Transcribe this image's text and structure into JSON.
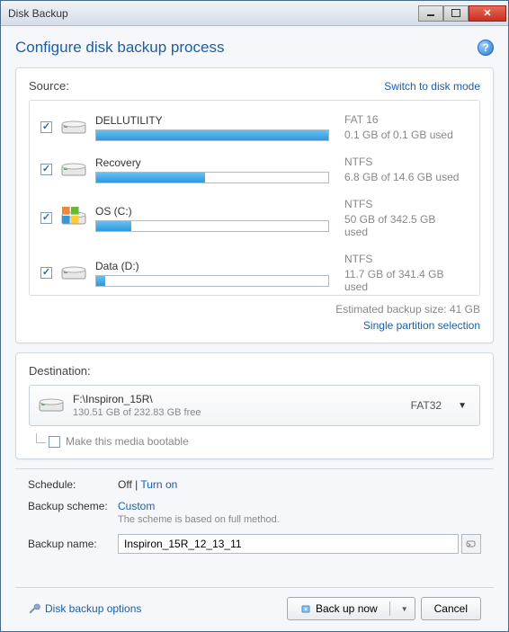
{
  "window": {
    "title": "Disk Backup"
  },
  "header": {
    "title": "Configure disk backup process"
  },
  "source": {
    "label": "Source:",
    "switch_link": "Switch to disk mode",
    "items": [
      {
        "name": "DELLUTILITY",
        "fs": "FAT 16",
        "usage": "0.1 GB of 0.1 GB used",
        "pct": 100,
        "checked": true,
        "os": false
      },
      {
        "name": "Recovery",
        "fs": "NTFS",
        "usage": "6.8 GB of 14.6 GB used",
        "pct": 47,
        "checked": true,
        "os": false
      },
      {
        "name": "OS (C:)",
        "fs": "NTFS",
        "usage": "50 GB of 342.5 GB used",
        "pct": 15,
        "checked": true,
        "os": true
      },
      {
        "name": "Data (D:)",
        "fs": "NTFS",
        "usage": "11.7 GB of 341.4 GB used",
        "pct": 4,
        "checked": true,
        "os": false
      }
    ],
    "estimated": "Estimated backup size: 41 GB",
    "single_link": "Single partition selection"
  },
  "destination": {
    "label": "Destination:",
    "path": "F:\\Inspiron_15R\\",
    "free": "130.51 GB of 232.83 GB free",
    "fs": "FAT32",
    "bootable_label": "Make this media bootable"
  },
  "settings": {
    "schedule_label": "Schedule:",
    "schedule_value": "Off",
    "schedule_sep": " | ",
    "schedule_link": "Turn on",
    "scheme_label": "Backup scheme:",
    "scheme_link": "Custom",
    "scheme_desc": "The scheme is based on full method.",
    "name_label": "Backup name:",
    "name_value": "Inspiron_15R_12_13_11"
  },
  "footer": {
    "options_link": "Disk backup options",
    "backup_btn": "Back up now",
    "cancel_btn": "Cancel"
  }
}
